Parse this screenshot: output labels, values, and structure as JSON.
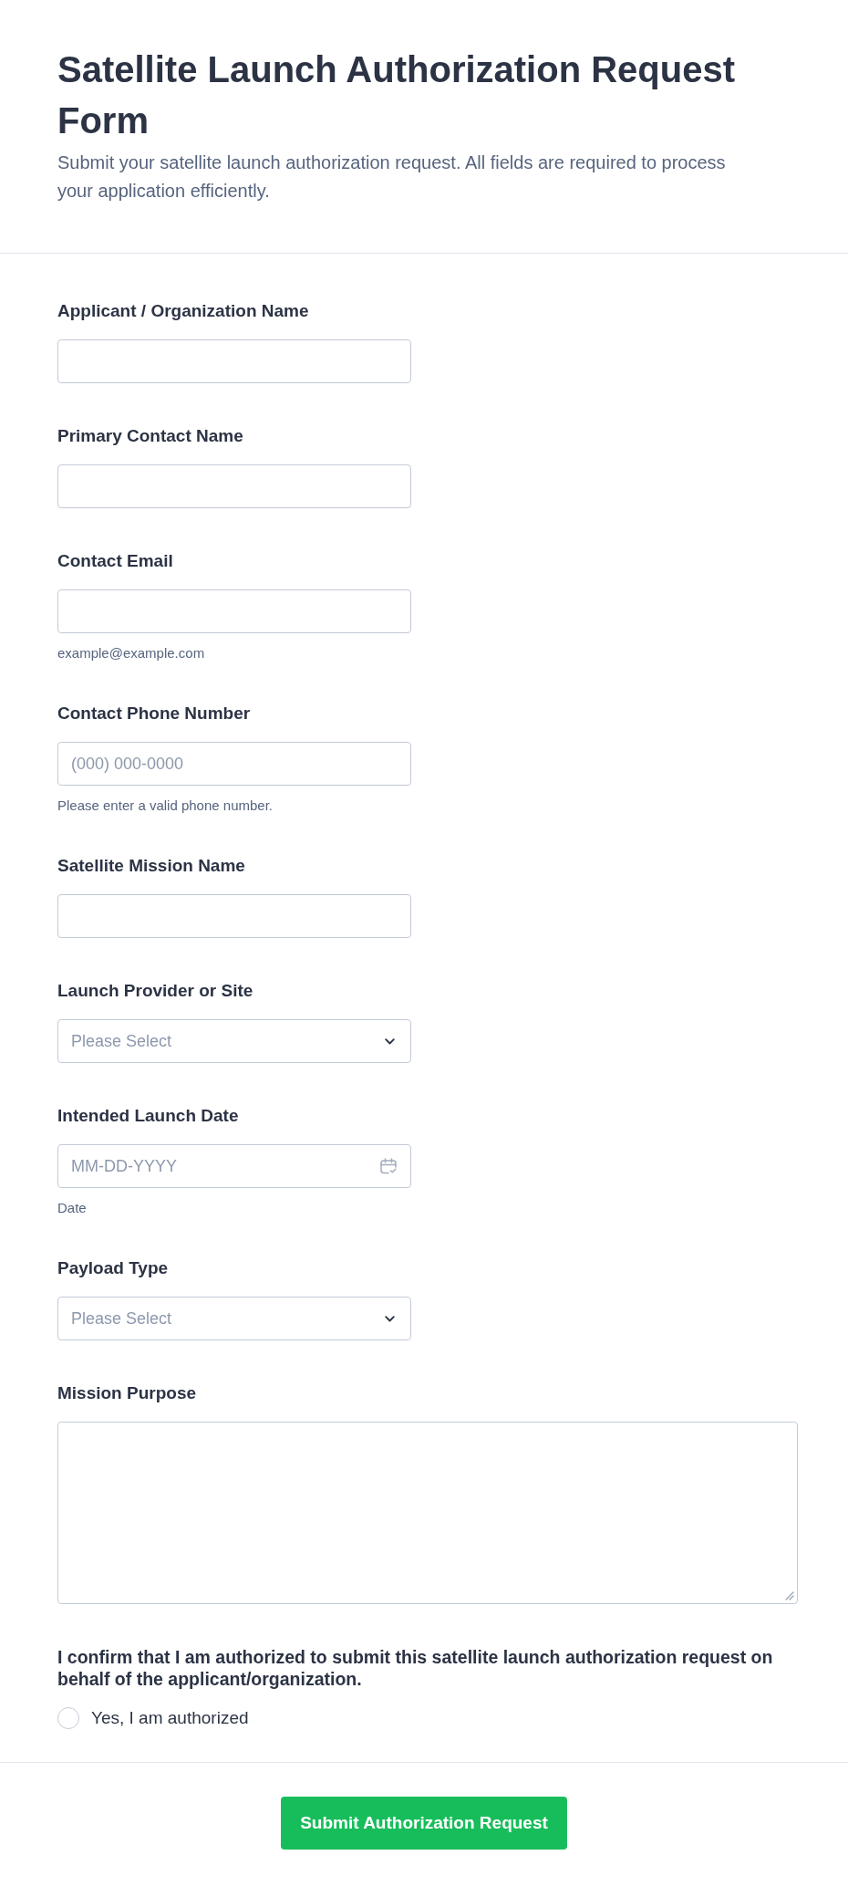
{
  "header": {
    "title": "Satellite Launch Authorization Request Form",
    "description": "Submit your satellite launch authorization request. All fields are required to process your application efficiently."
  },
  "fields": [
    {
      "kind": "text",
      "label": "Applicant / Organization Name"
    },
    {
      "kind": "text",
      "label": "Primary Contact Name"
    },
    {
      "kind": "text",
      "label": "Contact Email",
      "sublabel": "example@example.com"
    },
    {
      "kind": "text",
      "label": "Contact Phone Number",
      "placeholder": "(000) 000-0000",
      "sublabel": "Please enter a valid phone number."
    },
    {
      "kind": "text",
      "label": "Satellite Mission Name"
    },
    {
      "kind": "select",
      "label": "Launch Provider or Site",
      "placeholder": "Please Select"
    },
    {
      "kind": "date",
      "label": "Intended Launch Date",
      "placeholder": "MM-DD-YYYY",
      "sublabel": "Date"
    },
    {
      "kind": "select",
      "label": "Payload Type",
      "placeholder": "Please Select"
    },
    {
      "kind": "textarea",
      "label": "Mission Purpose"
    }
  ],
  "confirmation": {
    "question": "I confirm that I am authorized to submit this satellite launch authorization request on behalf of the applicant/organization.",
    "options": [
      {
        "label": "Yes, I am authorized",
        "selected": false
      }
    ]
  },
  "submit_button": {
    "label": "Submit Authorization Request"
  }
}
